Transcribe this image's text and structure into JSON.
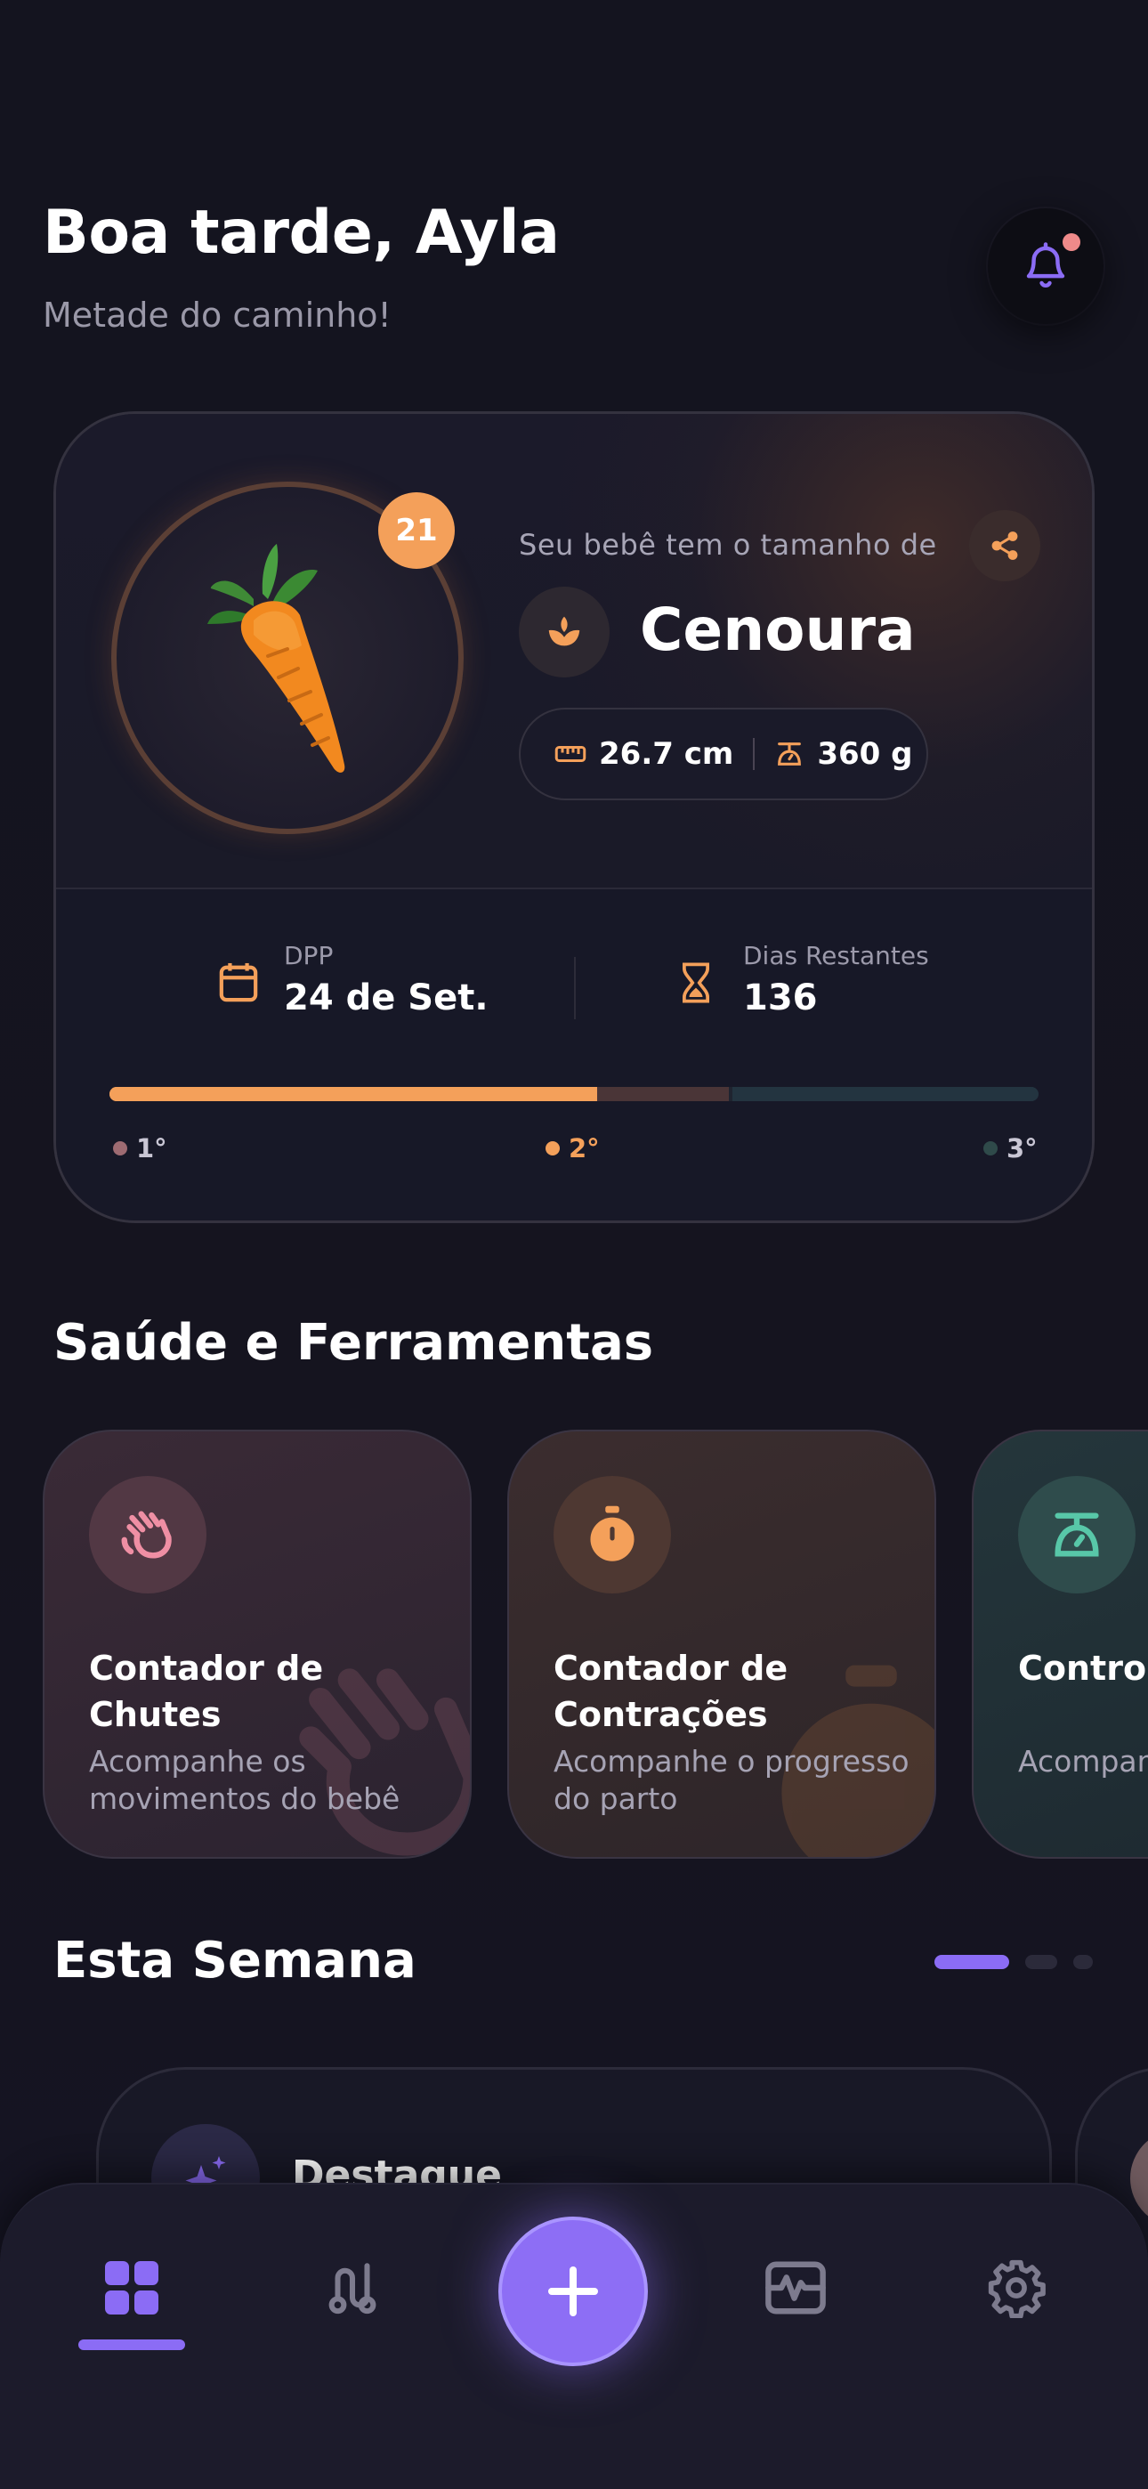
{
  "header": {
    "greeting": "Boa tarde, Ayla",
    "subtitle": "Metade do caminho!",
    "notification_icon": "bell-icon",
    "notification_dot_color": "#ef8a8a"
  },
  "hero": {
    "week": "21",
    "fruit_icon": "carrot-icon",
    "size_label": "Seu bebê tem o tamanho de",
    "fruit_name": "Cenoura",
    "length": "26.7 cm",
    "weight": "360 g",
    "due_date_label": "DPP",
    "due_date": "24 de Set.",
    "days_left_label": "Dias Restantes",
    "days_left": "136",
    "progress_fraction": 0.525,
    "trimesters": [
      "1°",
      "2°",
      "3°"
    ],
    "accent_color": "#f4a05a"
  },
  "tools": {
    "title": "Saúde e Ferramentas",
    "cards": [
      {
        "title": "Contador de Chutes",
        "desc": "Acompanhe os movimentos do bebê",
        "icon": "hand-wave-icon"
      },
      {
        "title": "Contador de Contrações",
        "desc": "Acompanhe o progresso do parto",
        "icon": "stopwatch-icon"
      },
      {
        "title": "Controle",
        "desc": "Acompanhe variações",
        "icon": "scale-icon"
      }
    ]
  },
  "week": {
    "title": "Esta Semana",
    "highlight_title": "Destaque",
    "highlight_icon": "sparkles-icon"
  },
  "nav": {
    "items": [
      "dashboard-icon",
      "route-icon",
      "add-icon",
      "activity-icon",
      "settings-icon"
    ],
    "active": "dashboard"
  }
}
